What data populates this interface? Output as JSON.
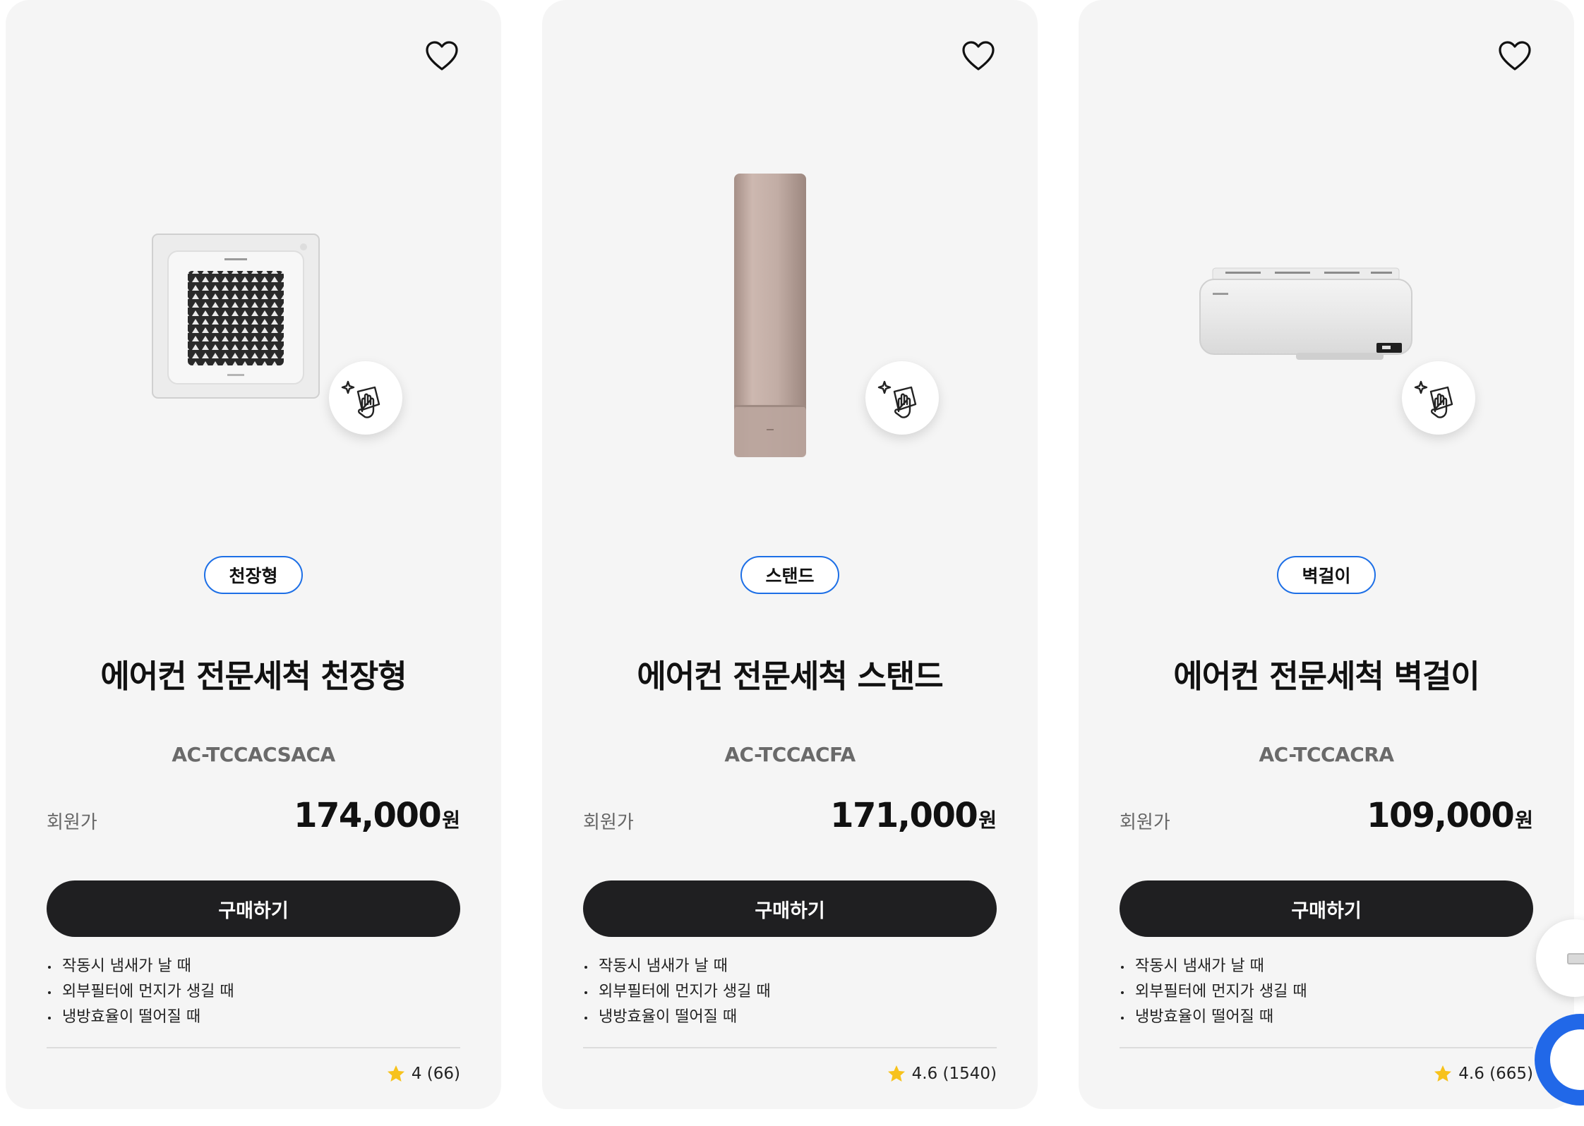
{
  "products": [
    {
      "category_tag": "천장형",
      "title": "에어컨 전문세척 천장형",
      "model": "AC-TCCACSACA",
      "price_label": "회원가",
      "price": "174,000",
      "currency": "원",
      "buy_label": "구매하기",
      "features": [
        "작동시 냄새가 날 때",
        "외부필터에 먼지가 생길 때",
        "냉방효율이 떨어질 때"
      ],
      "rating": "4 (66)",
      "product_image": "ceiling-cassette-ac"
    },
    {
      "category_tag": "스탠드",
      "title": "에어컨 전문세척 스탠드",
      "model": "AC-TCCACFA",
      "price_label": "회원가",
      "price": "171,000",
      "currency": "원",
      "buy_label": "구매하기",
      "features": [
        "작동시 냄새가 날 때",
        "외부필터에 먼지가 생길 때",
        "냉방효율이 떨어질 때"
      ],
      "rating": "4.6 (1540)",
      "product_image": "stand-ac"
    },
    {
      "category_tag": "벽걸이",
      "title": "에어컨 전문세척 벽걸이",
      "model": "AC-TCCACRA",
      "price_label": "회원가",
      "price": "109,000",
      "currency": "원",
      "buy_label": "구매하기",
      "features": [
        "작동시 냄새가 날 때",
        "외부필터에 먼지가 생길 때",
        "냉방효율이 떨어질 때"
      ],
      "rating": "4.6 (665)",
      "product_image": "wall-mounted-ac"
    }
  ],
  "icons": {
    "wishlist": "heart-icon",
    "cleaning_badge": "cleaning-hand-icon",
    "rating": "star-icon"
  },
  "colors": {
    "card_bg": "#f5f5f5",
    "tag_border": "#1d6fe6",
    "button_bg": "#1f1f21",
    "star": "#f7c21c",
    "chat_accent": "#2168e8"
  }
}
